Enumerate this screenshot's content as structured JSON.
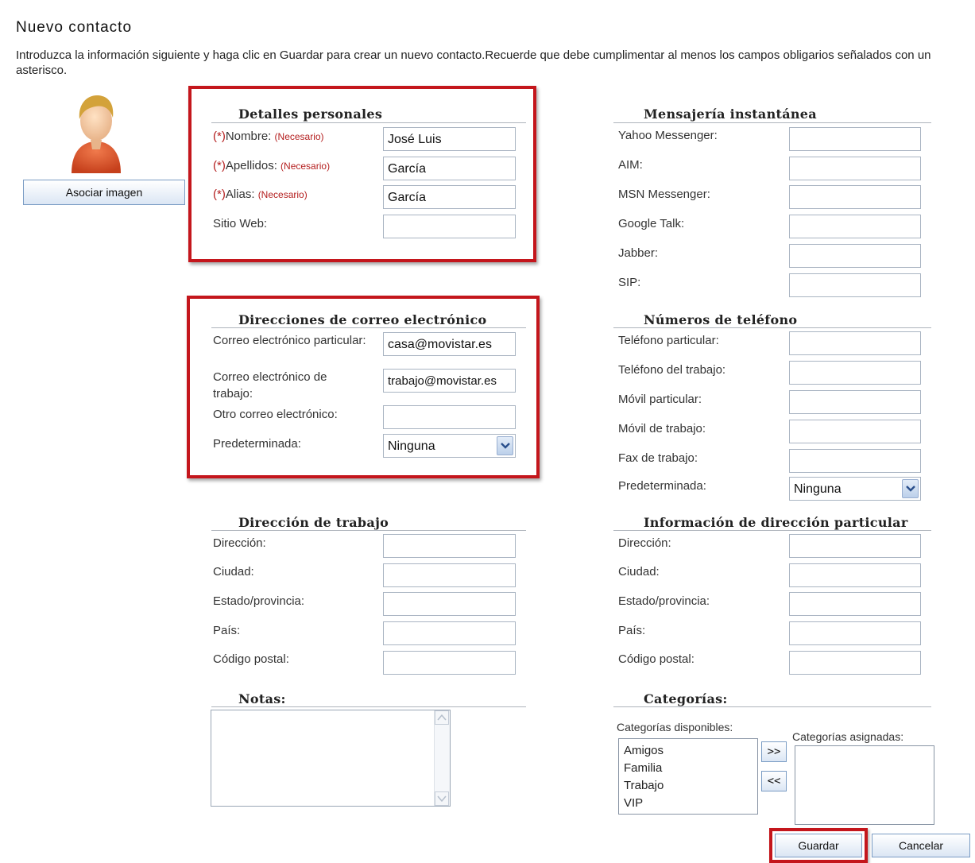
{
  "page": {
    "title": "Nuevo contacto",
    "intro": "Introduzca la información siguiente y haga clic en Guardar para crear un nuevo contacto.Recuerde que debe cumplimentar al menos los campos obligarios señalados con un asterisco."
  },
  "avatar": {
    "icon": "user-avatar-icon",
    "button_label": "Asociar imagen"
  },
  "personal": {
    "title": "Detalles personales",
    "required_mark": "(*)",
    "required_note": "(Necesario)",
    "fields": [
      {
        "label": "Nombre:",
        "value": "José Luis",
        "required": true
      },
      {
        "label": "Apellidos:",
        "value": "García",
        "required": true
      },
      {
        "label": "Alias:",
        "value": "García",
        "required": true
      },
      {
        "label": "Sitio Web:",
        "value": "",
        "required": false
      }
    ]
  },
  "email": {
    "title": "Direcciones de correo electrónico",
    "fields": [
      {
        "label": "Correo electrónico particular:",
        "value": "casa@movistar.es"
      },
      {
        "label": "Correo electrónico de trabajo:",
        "value": "trabajo@movistar.es"
      },
      {
        "label": "Otro correo electrónico:",
        "value": ""
      }
    ],
    "default_label": "Predeterminada:",
    "default_value": "Ninguna"
  },
  "work_address": {
    "title": "Dirección de trabajo",
    "fields": [
      "Dirección:",
      "Ciudad:",
      "Estado/provincia:",
      "País:",
      "Código postal:"
    ]
  },
  "notes": {
    "title": "Notas:"
  },
  "im": {
    "title": "Mensajería instantánea",
    "fields": [
      "Yahoo Messenger:",
      "AIM:",
      "MSN Messenger:",
      "Google Talk:",
      "Jabber:",
      "SIP:"
    ]
  },
  "phones": {
    "title": "Números de teléfono",
    "fields": [
      "Teléfono particular:",
      "Teléfono del trabajo:",
      "Móvil particular:",
      "Móvil de trabajo:",
      "Fax de trabajo:"
    ],
    "default_label": "Predeterminada:",
    "default_value": "Ninguna"
  },
  "home_address": {
    "title": "Información de dirección particular",
    "fields": [
      "Dirección:",
      "Ciudad:",
      "Estado/provincia:",
      "País:",
      "Código postal:"
    ]
  },
  "categories": {
    "title": "Categorías:",
    "available_label": "Categorías disponibles:",
    "assigned_label": "Categorías asignadas:",
    "available": [
      "Amigos",
      "Familia",
      "Trabajo",
      "VIP"
    ],
    "assigned": [],
    "add_label": ">>",
    "remove_label": "<<"
  },
  "actions": {
    "save_label": "Guardar",
    "cancel_label": "Cancelar"
  },
  "colors": {
    "highlight": "#c4161c",
    "required": "#b41e1e",
    "input_border": "#a9b4c2"
  }
}
